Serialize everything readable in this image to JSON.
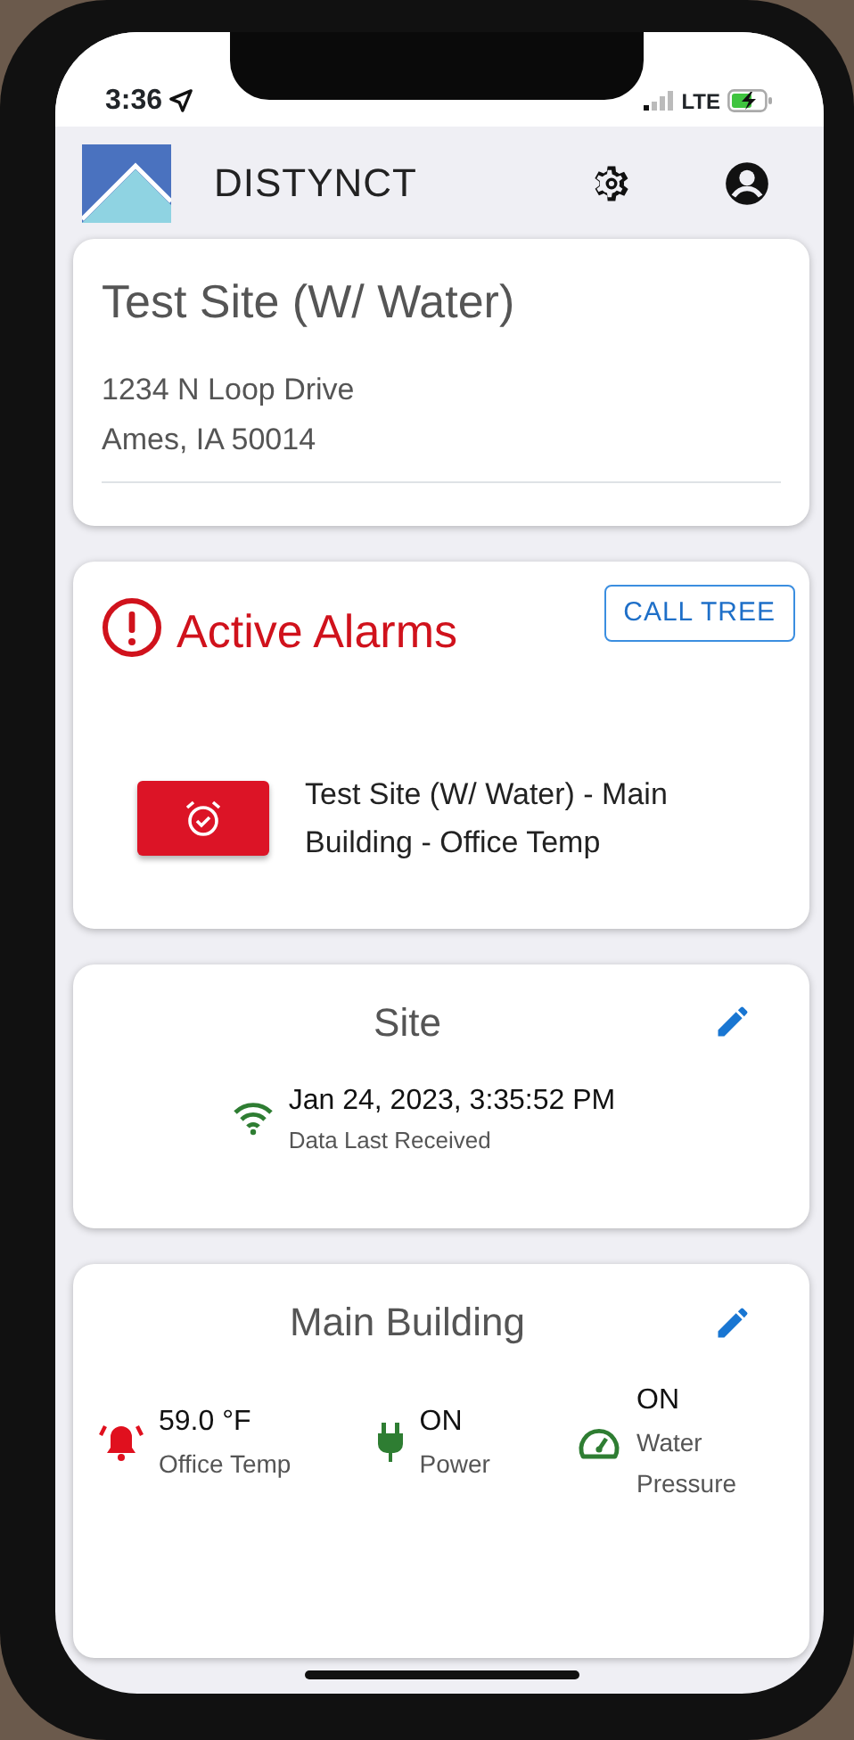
{
  "status_bar": {
    "time": "3:36",
    "network": "LTE"
  },
  "app_bar": {
    "title": "DISTYNCT"
  },
  "site_card": {
    "title": "Test Site (W/ Water)",
    "address_lines": [
      "1234 N Loop Drive",
      "Ames, IA 50014"
    ]
  },
  "alarms_card": {
    "title": "Active Alarms",
    "button": "CALL TREE",
    "alarms": [
      {
        "text": "Test Site (W/ Water) - Main Building - Office Temp"
      }
    ]
  },
  "status_card": {
    "title": "Site",
    "timestamp": "Jan 24, 2023, 3:35:52 PM",
    "caption": "Data Last Received"
  },
  "building_card": {
    "title": "Main Building",
    "sensors": [
      {
        "kind": "bell",
        "color": "#e0101e",
        "value": "59.0 °F",
        "label": "Office Temp"
      },
      {
        "kind": "plug",
        "color": "#2e7d32",
        "value": "ON",
        "label": "Power"
      },
      {
        "kind": "gauge",
        "color": "#2e7d32",
        "value": "ON",
        "label": "Water Pressure"
      }
    ]
  }
}
